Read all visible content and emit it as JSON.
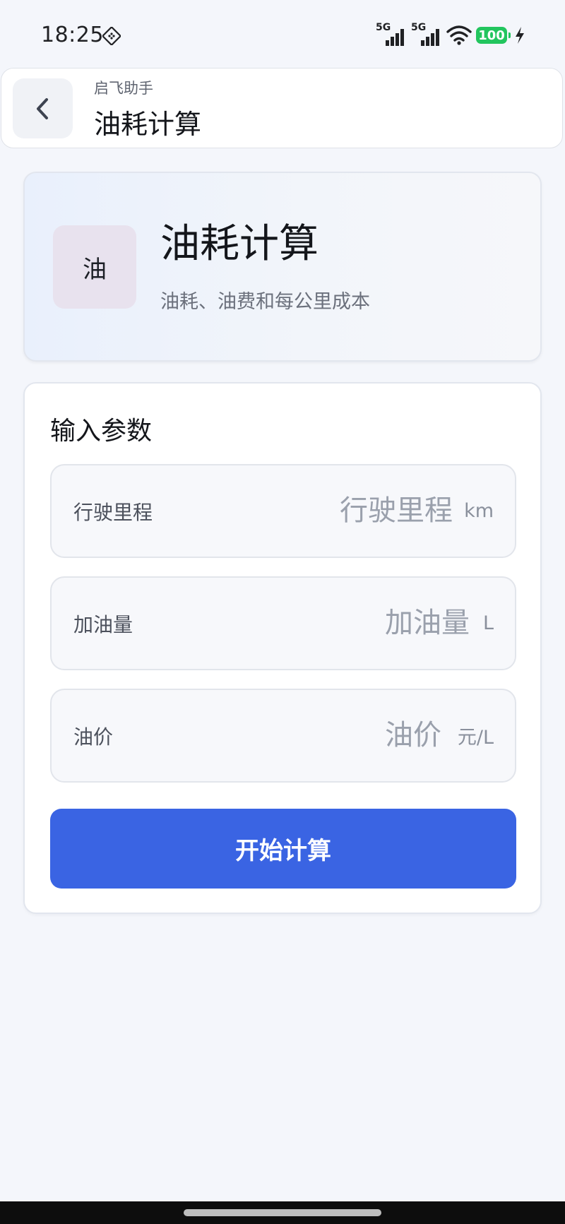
{
  "status_bar": {
    "time": "18:25",
    "network_1": "5G",
    "network_2": "5G",
    "battery": "100"
  },
  "header": {
    "subtitle": "启飞助手",
    "title": "油耗计算"
  },
  "hero": {
    "icon_text": "油",
    "title": "油耗计算",
    "description": "油耗、油费和每公里成本"
  },
  "params": {
    "title": "输入参数",
    "fields": [
      {
        "label": "行驶里程",
        "placeholder": "行驶里程",
        "unit": "km",
        "value": ""
      },
      {
        "label": "加油量",
        "placeholder": "加油量",
        "unit": "L",
        "value": ""
      },
      {
        "label": "油价",
        "placeholder": "油价",
        "unit": "元/L",
        "value": ""
      }
    ],
    "submit_label": "开始计算"
  },
  "colors": {
    "primary": "#3a64e3",
    "battery": "#22c55e",
    "background": "#f4f6fb"
  },
  "icons": [
    "back-chevron-icon",
    "app-status-icon",
    "signal-icon",
    "wifi-icon",
    "battery-icon",
    "charging-icon"
  ]
}
